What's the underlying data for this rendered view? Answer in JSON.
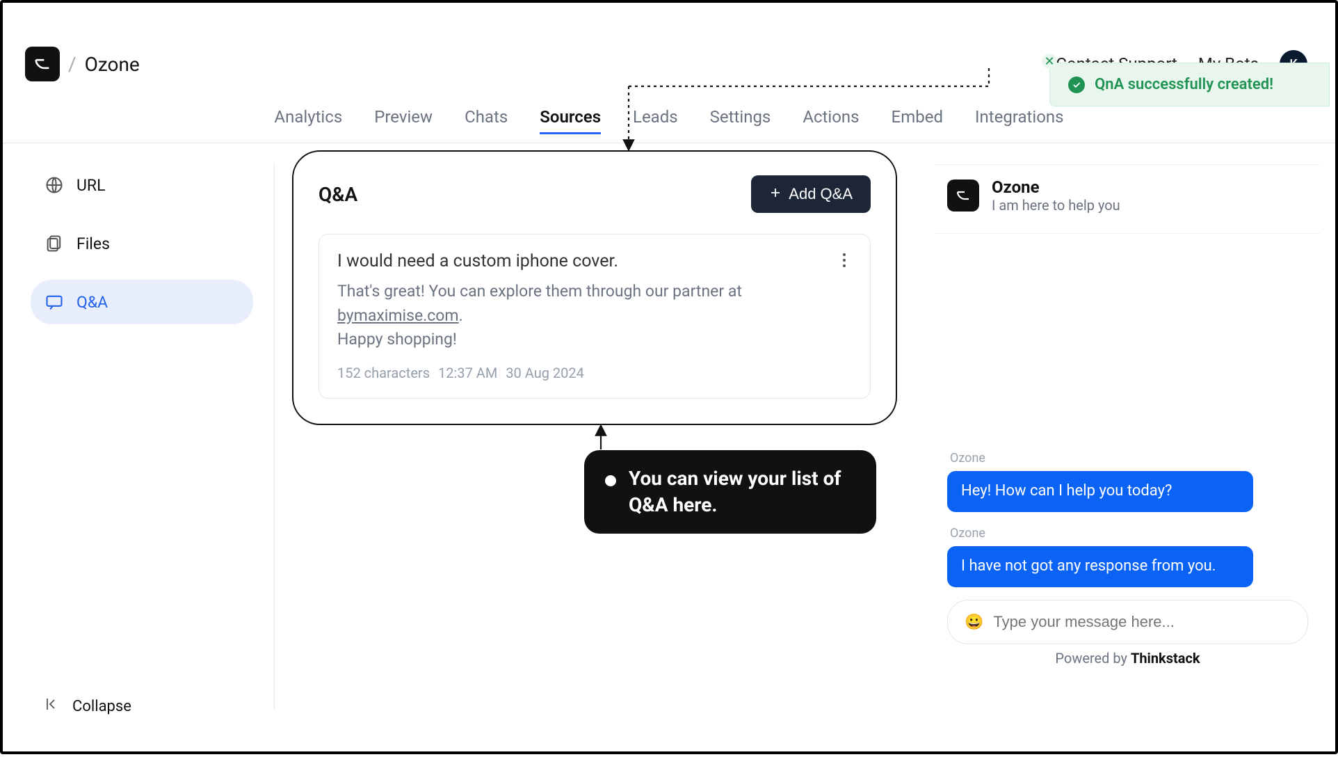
{
  "breadcrumb": {
    "name": "Ozone"
  },
  "topbar": {
    "contact": "Contact Support",
    "mybots": "My Bots",
    "avatar_letter": "K"
  },
  "tabs": [
    "Analytics",
    "Preview",
    "Chats",
    "Sources",
    "Leads",
    "Settings",
    "Actions",
    "Embed",
    "Integrations"
  ],
  "tabs_active_index": 3,
  "sidebar": {
    "items": [
      {
        "label": "URL",
        "icon": "globe"
      },
      {
        "label": "Files",
        "icon": "files"
      },
      {
        "label": "Q&A",
        "icon": "qa"
      }
    ],
    "active_index": 2,
    "collapse_label": "Collapse"
  },
  "qa": {
    "title": "Q&A",
    "add_label": "Add Q&A",
    "card": {
      "question": "I would need a custom iphone cover.",
      "answer_prefix": "That's great! You can explore them through our partner at ",
      "answer_link": "bymaximise.com",
      "answer_suffix": ".",
      "answer_line2": "Happy shopping!",
      "char_count": "152 characters",
      "time": "12:37 AM",
      "date": "30 Aug 2024"
    }
  },
  "tooltip": "You can view your list of Q&A here.",
  "toast": {
    "text": "QnA successfully created!"
  },
  "chat": {
    "bot_name": "Ozone",
    "bot_sub": "I am here to help you",
    "messages": [
      {
        "sender": "Ozone",
        "text": "Hey! How can I help you today?"
      },
      {
        "sender": "Ozone",
        "text": "I have not got any response from you."
      }
    ],
    "input_placeholder": "Type your message here...",
    "powered_prefix": "Powered by ",
    "powered_brand": "Thinkstack"
  }
}
